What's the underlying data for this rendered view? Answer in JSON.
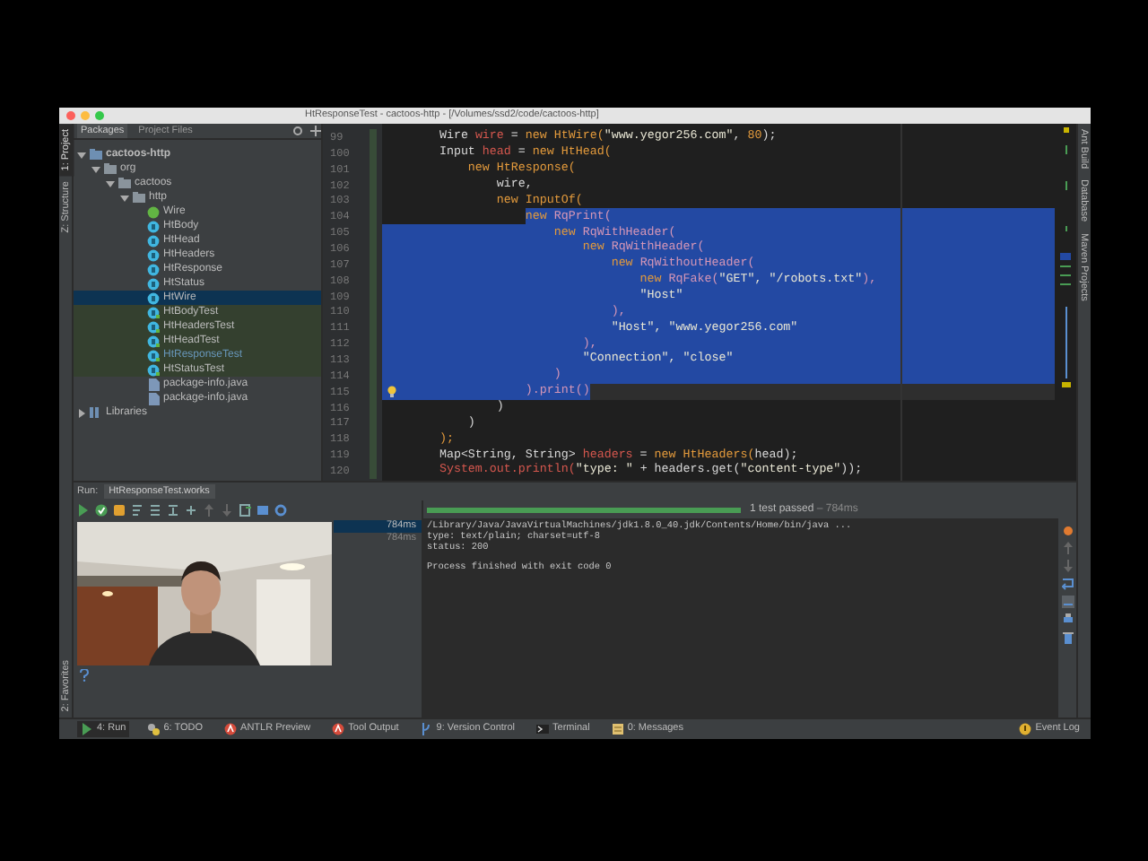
{
  "window": {
    "title": "HtResponseTest - cactoos-http - [/Volumes/ssd2/code/cactoos-http]"
  },
  "left_strip": {
    "top": [
      {
        "label": "1: Project",
        "selected": true
      },
      {
        "label": "Z: Structure",
        "selected": false
      }
    ],
    "bottom": [
      {
        "label": "2: Favorites",
        "selected": false
      }
    ]
  },
  "right_strip": [
    {
      "label": "Ant Build"
    },
    {
      "label": "Database"
    },
    {
      "label": "Maven Projects"
    }
  ],
  "project": {
    "tabs": [
      {
        "label": "Packages",
        "selected": true
      },
      {
        "label": "Project Files",
        "selected": false
      }
    ],
    "tree": [
      {
        "label": "cactoos-http",
        "kind": "module",
        "expanded": true,
        "children": [
          {
            "label": "org",
            "kind": "package",
            "expanded": true,
            "children": [
              {
                "label": "cactoos",
                "kind": "package",
                "expanded": true,
                "children": [
                  {
                    "label": "http",
                    "kind": "package",
                    "expanded": true,
                    "children": [
                      {
                        "label": "Wire",
                        "kind": "interface",
                        "selected": false,
                        "modified": false
                      },
                      {
                        "label": "HtBody",
                        "kind": "class",
                        "selected": false,
                        "modified": false
                      },
                      {
                        "label": "HtHead",
                        "kind": "class",
                        "selected": false,
                        "modified": false
                      },
                      {
                        "label": "HtHeaders",
                        "kind": "class",
                        "selected": false,
                        "modified": false
                      },
                      {
                        "label": "HtResponse",
                        "kind": "class",
                        "selected": false,
                        "modified": false
                      },
                      {
                        "label": "HtStatus",
                        "kind": "class",
                        "selected": false,
                        "modified": false
                      },
                      {
                        "label": "HtWire",
                        "kind": "class",
                        "selected": true,
                        "modified": false
                      },
                      {
                        "label": "HtBodyTest",
                        "kind": "test",
                        "selected": false,
                        "modified": false
                      },
                      {
                        "label": "HtHeadersTest",
                        "kind": "test",
                        "selected": false,
                        "modified": false
                      },
                      {
                        "label": "HtHeadTest",
                        "kind": "test",
                        "selected": false,
                        "modified": false
                      },
                      {
                        "label": "HtResponseTest",
                        "kind": "test",
                        "selected": false,
                        "modified": true
                      },
                      {
                        "label": "HtStatusTest",
                        "kind": "test",
                        "selected": false,
                        "modified": false
                      },
                      {
                        "label": "package-info.java",
                        "kind": "file",
                        "selected": false,
                        "modified": false
                      },
                      {
                        "label": "package-info.java",
                        "kind": "file",
                        "selected": false,
                        "modified": false
                      }
                    ]
                  }
                ]
              }
            ]
          }
        ]
      },
      {
        "label": "Libraries",
        "kind": "library",
        "expanded": false
      }
    ]
  },
  "editor": {
    "lines": [
      {
        "no": "99",
        "kind": "plain",
        "code": [
          {
            "kind": "id",
            "text": "        Wire "
          },
          {
            "kind": "var",
            "text": "wire"
          },
          {
            "kind": "id",
            "text": " = "
          },
          {
            "kind": "kw",
            "text": "new HtWire("
          },
          {
            "kind": "str",
            "text": "\"www.yegor256.com\""
          },
          {
            "kind": "id",
            "text": ", "
          },
          {
            "kind": "kw",
            "text": "80"
          },
          {
            "kind": "id",
            "text": ");"
          }
        ]
      },
      {
        "no": "100",
        "kind": "plain",
        "code": [
          {
            "kind": "id",
            "text": "        Input "
          },
          {
            "kind": "var",
            "text": "head"
          },
          {
            "kind": "id",
            "text": " = "
          },
          {
            "kind": "kw",
            "text": "new HtHead("
          }
        ]
      },
      {
        "no": "101",
        "kind": "plain",
        "code": [
          {
            "kind": "kw",
            "text": "            new HtResponse("
          }
        ]
      },
      {
        "no": "102",
        "kind": "plain",
        "code": [
          {
            "kind": "id",
            "text": "                wire,"
          }
        ]
      },
      {
        "no": "103",
        "kind": "plain",
        "code": [
          {
            "kind": "kw",
            "text": "                new InputOf("
          }
        ]
      },
      {
        "no": "104",
        "kind": "sel_tail",
        "code": [
          {
            "kind": "kw",
            "text": "                    new "
          },
          {
            "kind": "call",
            "text": "RqPrint("
          }
        ]
      },
      {
        "no": "105",
        "kind": "sel_full",
        "code": [
          {
            "kind": "kw",
            "text": "                        new "
          },
          {
            "kind": "call",
            "text": "RqWithHeader("
          }
        ]
      },
      {
        "no": "106",
        "kind": "sel_full",
        "code": [
          {
            "kind": "kw",
            "text": "                            new "
          },
          {
            "kind": "call",
            "text": "RqWithHeader("
          }
        ]
      },
      {
        "no": "107",
        "kind": "sel_full",
        "code": [
          {
            "kind": "kw",
            "text": "                                new "
          },
          {
            "kind": "call",
            "text": "RqWithoutHeader("
          }
        ]
      },
      {
        "no": "108",
        "kind": "sel_full",
        "code": [
          {
            "kind": "kw",
            "text": "                                    new "
          },
          {
            "kind": "call",
            "text": "RqFake("
          },
          {
            "kind": "str",
            "text": "\"GET\", \"/robots.txt\""
          },
          {
            "kind": "call",
            "text": "),"
          }
        ]
      },
      {
        "no": "109",
        "kind": "sel_full",
        "code": [
          {
            "kind": "str",
            "text": "                                    \"Host\""
          }
        ]
      },
      {
        "no": "110",
        "kind": "sel_full",
        "code": [
          {
            "kind": "call",
            "text": "                                ),"
          }
        ]
      },
      {
        "no": "111",
        "kind": "sel_full",
        "code": [
          {
            "kind": "str",
            "text": "                                \"Host\", \"www.yegor256.com\""
          }
        ]
      },
      {
        "no": "112",
        "kind": "sel_full",
        "code": [
          {
            "kind": "call",
            "text": "                            ),"
          }
        ]
      },
      {
        "no": "113",
        "kind": "sel_full",
        "code": [
          {
            "kind": "str",
            "text": "                            \"Connection\", \"close\""
          }
        ]
      },
      {
        "no": "114",
        "kind": "sel_full",
        "code": [
          {
            "kind": "call",
            "text": "                        )"
          }
        ]
      },
      {
        "no": "115",
        "kind": "caret",
        "code": [
          {
            "kind": "call",
            "text": "                    ).print()"
          }
        ]
      },
      {
        "no": "116",
        "kind": "plain",
        "code": [
          {
            "kind": "id",
            "text": "                )"
          }
        ]
      },
      {
        "no": "117",
        "kind": "plain",
        "code": [
          {
            "kind": "id",
            "text": "            )"
          }
        ]
      },
      {
        "no": "118",
        "kind": "plain",
        "code": [
          {
            "kind": "kw",
            "text": "        );"
          }
        ]
      },
      {
        "no": "119",
        "kind": "plain",
        "code": [
          {
            "kind": "id",
            "text": "        Map<String, String> "
          },
          {
            "kind": "var",
            "text": "headers"
          },
          {
            "kind": "id",
            "text": " = "
          },
          {
            "kind": "kw",
            "text": "new HtHeaders("
          },
          {
            "kind": "id",
            "text": "head);"
          }
        ]
      },
      {
        "no": "120",
        "kind": "plain",
        "code": [
          {
            "kind": "var",
            "text": "        System.out.println("
          },
          {
            "kind": "str",
            "text": "\"type: \""
          },
          {
            "kind": "id",
            "text": " + headers.get("
          },
          {
            "kind": "str",
            "text": "\"content-type\""
          },
          {
            "kind": "id",
            "text": "));"
          }
        ]
      }
    ]
  },
  "run": {
    "label": "Run:",
    "tab": "HtResponseTest.works",
    "tests": [
      {
        "time": "784ms",
        "selected": true
      },
      {
        "time": "784ms",
        "selected": false
      }
    ],
    "progress": {
      "level": 1,
      "status": "1 test passed",
      "time": "– 784ms"
    },
    "console": [
      [
        "/Library/Java/JavaVirtualMachines/jdk1.8.0_40.jdk/Contents/Home/bin/java ...",
        "type: text/plain; charset=utf-8",
        "status: 200"
      ],
      [
        "Process finished with exit code 0"
      ]
    ]
  },
  "status_bar": {
    "items": [
      {
        "label": "4: Run",
        "kind": "run",
        "selected": true
      },
      {
        "label": "6: TODO",
        "kind": "todo",
        "selected": false
      },
      {
        "label": "ANTLR Preview",
        "kind": "antlr",
        "selected": false
      },
      {
        "label": "Tool Output",
        "kind": "antlr",
        "selected": false
      },
      {
        "label": "9: Version Control",
        "kind": "vcs",
        "selected": false
      },
      {
        "label": "Terminal",
        "kind": "terminal",
        "selected": false
      },
      {
        "label": "0: Messages",
        "kind": "messages",
        "selected": false
      }
    ],
    "event_log": "Event Log"
  }
}
